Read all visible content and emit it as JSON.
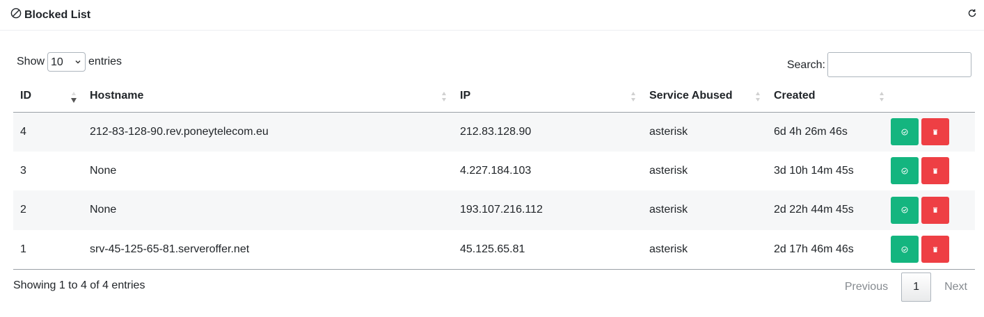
{
  "header": {
    "title": "Blocked List",
    "icon": "ban-icon",
    "refresh_icon": "refresh-icon"
  },
  "length": {
    "show_label": "Show",
    "value": "10",
    "entries_label": "entries",
    "options": [
      "10"
    ]
  },
  "search": {
    "label": "Search:",
    "value": ""
  },
  "table": {
    "columns": [
      "ID",
      "Hostname",
      "IP",
      "Service Abused",
      "Created"
    ],
    "sorted_column": "ID",
    "sort_direction": "desc",
    "rows": [
      {
        "id": "4",
        "hostname": "212-83-128-90.rev.poneytelecom.eu",
        "ip": "212.83.128.90",
        "service": "asterisk",
        "created": "6d 4h 26m 46s"
      },
      {
        "id": "3",
        "hostname": "None",
        "ip": "4.227.184.103",
        "service": "asterisk",
        "created": "3d 10h 14m 45s"
      },
      {
        "id": "2",
        "hostname": "None",
        "ip": "193.107.216.112",
        "service": "asterisk",
        "created": "2d 22h 44m 45s"
      },
      {
        "id": "1",
        "hostname": "srv-45-125-65-81.serveroffer.net",
        "ip": "45.125.65.81",
        "service": "asterisk",
        "created": "2d 17h 46m 46s"
      }
    ],
    "action_icons": {
      "unblock": "check-circle-icon",
      "delete": "trash-icon"
    }
  },
  "footer": {
    "info": "Showing 1 to 4 of 4 entries",
    "previous": "Previous",
    "current_page": "1",
    "next": "Next"
  },
  "colors": {
    "unblock": "#14b57f",
    "delete": "#ee3f44"
  }
}
